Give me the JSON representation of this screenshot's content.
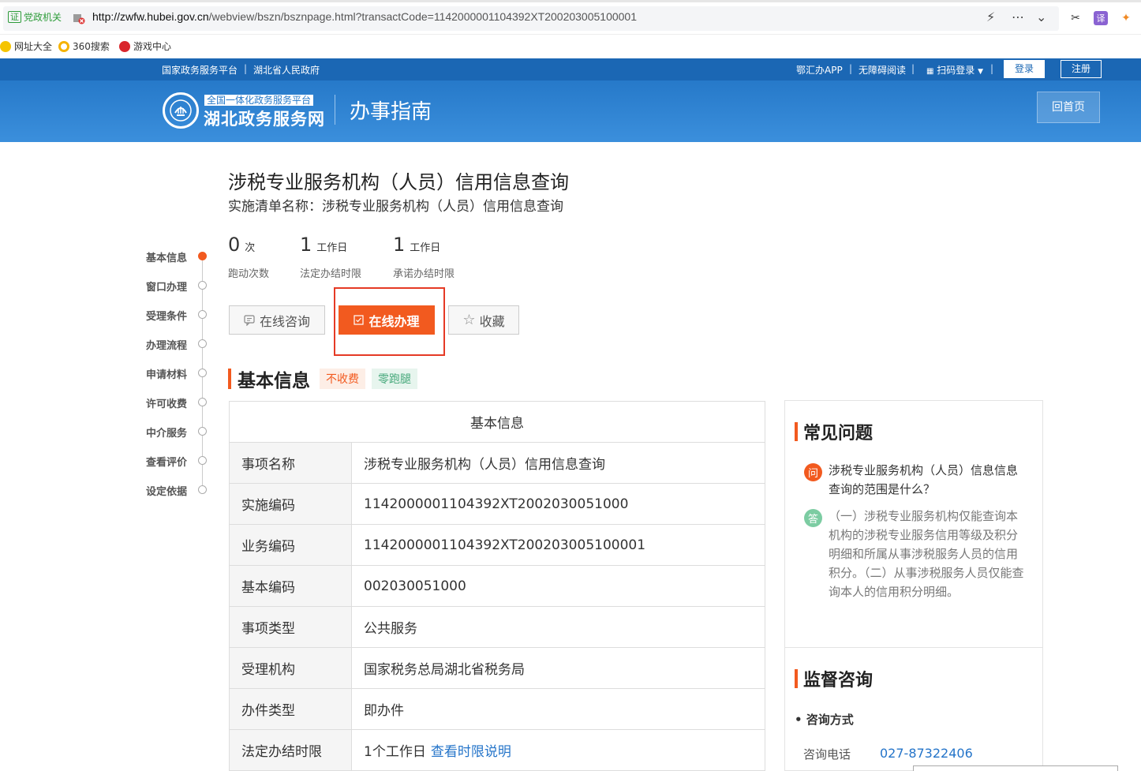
{
  "browser": {
    "cert_badge": "证",
    "cert_label": "党政机关",
    "url_domain": "http://zwfw.hubei.gov.cn",
    "url_path": "/webview/bszn/bsznpage.html?transactCode=1142000001104392XT200203005100001",
    "bookmarks": [
      "网址大全",
      "360搜索",
      "游戏中心"
    ],
    "translate_label": "译"
  },
  "site": {
    "top_links": [
      "国家政务服务平台",
      "湖北省人民政府"
    ],
    "right_links": [
      "鄂汇办APP",
      "无障碍阅读",
      "扫码登录"
    ],
    "login": "登录",
    "register": "注册",
    "logo_sub": "全国一体化政务服务平台",
    "logo_main": "湖北政务服务网",
    "section_title": "办事指南",
    "home_button": "回首页"
  },
  "page": {
    "title": "涉税专业服务机构（人员）信用信息查询",
    "impl_name": "实施清单名称：涉税专业服务机构（人员）信用信息查询"
  },
  "side_nav": [
    "基本信息",
    "窗口办理",
    "受理条件",
    "办理流程",
    "申请材料",
    "许可收费",
    "中介服务",
    "查看评价",
    "设定依据"
  ],
  "stats": [
    {
      "num": "0",
      "unit": "次",
      "label": "跑动次数"
    },
    {
      "num": "1",
      "unit": "工作日",
      "label": "法定办结时限"
    },
    {
      "num": "1",
      "unit": "工作日",
      "label": "承诺办结时限"
    }
  ],
  "actions": {
    "consult": "在线咨询",
    "online": "在线办理",
    "collect": "收藏"
  },
  "basic_section": {
    "title": "基本信息",
    "tag_fee": "不收费",
    "tag_run": "零跑腿",
    "table_title": "基本信息",
    "rows": [
      {
        "k": "事项名称",
        "v": "涉税专业服务机构（人员）信用信息查询"
      },
      {
        "k": "实施编码",
        "v": "1142000001104392XT2002030051000"
      },
      {
        "k": "业务编码",
        "v": "1142000001104392XT200203005100001"
      },
      {
        "k": "基本编码",
        "v": "002030051000"
      },
      {
        "k": "事项类型",
        "v": "公共服务"
      },
      {
        "k": "受理机构",
        "v": "国家税务总局湖北省税务局"
      },
      {
        "k": "办件类型",
        "v": "即办件"
      },
      {
        "k": "法定办结时限",
        "v": "1个工作日"
      }
    ],
    "time_link": "查看时限说明"
  },
  "faq": {
    "title": "常见问题",
    "q_badge": "问",
    "a_badge": "答",
    "question": "涉税专业服务机构（人员）信息信息查询的范围是什么？",
    "answer": "（一）涉税专业服务机构仅能查询本机构的涉税专业服务信用等级及积分明细和所属从事涉税服务人员的信用积分。（二）从事涉税服务人员仅能查询本人的信用积分明细。"
  },
  "supervise": {
    "title": "监督咨询",
    "sub": "• 咨询方式",
    "phone_label": "咨询电话",
    "phone": "027-87322406"
  },
  "colors": {
    "accent": "#f25a1f",
    "brand": "#2679c9",
    "link": "#2474c9"
  }
}
